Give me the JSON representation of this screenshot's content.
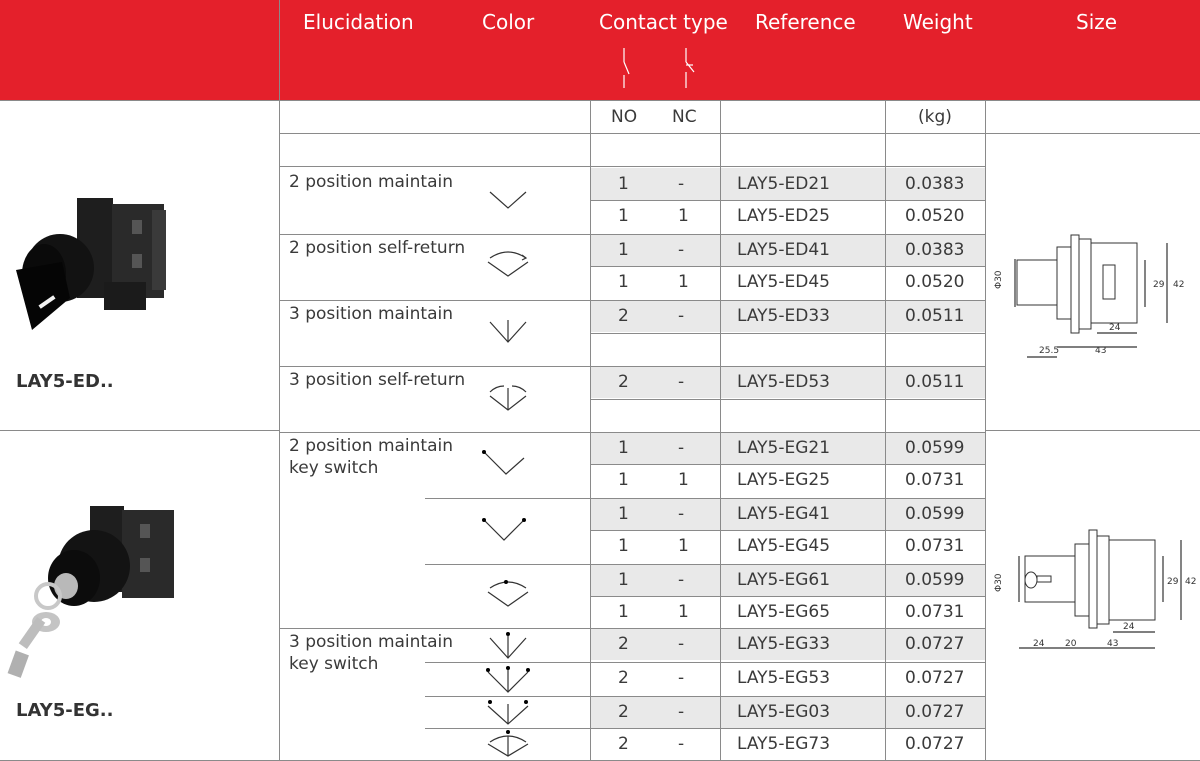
{
  "header": {
    "elucidation": "Elucidation",
    "color": "Color",
    "contact_type": "Contact type",
    "reference": "Reference",
    "weight": "Weight",
    "size": "Size"
  },
  "subheader": {
    "no": "NO",
    "nc": "NC",
    "unit": "(kg)"
  },
  "products": [
    {
      "name": "LAY5-ED.."
    },
    {
      "name": "LAY5-EG.."
    }
  ],
  "descriptions": [
    {
      "lines": [
        "2 position maintain"
      ]
    },
    {
      "lines": [
        "2 position self-return"
      ]
    },
    {
      "lines": [
        "3 position maintain"
      ]
    },
    {
      "lines": [
        "3 position self-return"
      ]
    },
    {
      "lines": [
        "2 position maintain",
        "key switch"
      ]
    },
    {
      "lines": [
        "3 position maintain",
        "key switch"
      ]
    }
  ],
  "rows": [
    {
      "no": "1",
      "nc": "-",
      "ref": "LAY5-ED21",
      "weight": "0.0383"
    },
    {
      "no": "1",
      "nc": "1",
      "ref": "LAY5-ED25",
      "weight": "0.0520"
    },
    {
      "no": "1",
      "nc": "-",
      "ref": "LAY5-ED41",
      "weight": "0.0383"
    },
    {
      "no": "1",
      "nc": "1",
      "ref": "LAY5-ED45",
      "weight": "0.0520"
    },
    {
      "no": "2",
      "nc": "-",
      "ref": "LAY5-ED33",
      "weight": "0.0511"
    },
    {
      "no": "2",
      "nc": "-",
      "ref": "LAY5-ED53",
      "weight": "0.0511"
    },
    {
      "no": "1",
      "nc": "-",
      "ref": "LAY5-EG21",
      "weight": "0.0599"
    },
    {
      "no": "1",
      "nc": "1",
      "ref": "LAY5-EG25",
      "weight": "0.0731"
    },
    {
      "no": "1",
      "nc": "-",
      "ref": "LAY5-EG41",
      "weight": "0.0599"
    },
    {
      "no": "1",
      "nc": "1",
      "ref": "LAY5-EG45",
      "weight": "0.0731"
    },
    {
      "no": "1",
      "nc": "-",
      "ref": "LAY5-EG61",
      "weight": "0.0599"
    },
    {
      "no": "1",
      "nc": "1",
      "ref": "LAY5-EG65",
      "weight": "0.0731"
    },
    {
      "no": "2",
      "nc": "-",
      "ref": "LAY5-EG33",
      "weight": "0.0727"
    },
    {
      "no": "2",
      "nc": "-",
      "ref": "LAY5-EG53",
      "weight": "0.0727"
    },
    {
      "no": "2",
      "nc": "-",
      "ref": "LAY5-EG03",
      "weight": "0.0727"
    },
    {
      "no": "2",
      "nc": "-",
      "ref": "LAY5-EG73",
      "weight": "0.0727"
    }
  ],
  "drawing_ed": {
    "dia": "Φ30",
    "d1": "29",
    "d2": "42",
    "d3": "24",
    "d4": "25.5",
    "d5": "43"
  },
  "drawing_eg": {
    "dia": "Φ30",
    "d1": "29",
    "d2": "42",
    "d3": "24",
    "d4": "24",
    "d5": "20",
    "d6": "43"
  },
  "colors": {
    "header_bg": "#e4202b",
    "row_gray": "#e9e9e9",
    "text": "#3a3a3a"
  }
}
